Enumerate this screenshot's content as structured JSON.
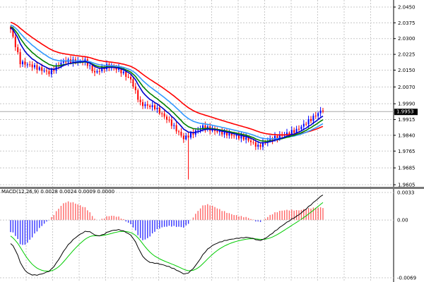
{
  "chart_data": {
    "type": "candlestick",
    "main": {
      "price_axis_labels": [
        "2.0450",
        "2.0375",
        "2.0300",
        "2.0225",
        "2.0150",
        "2.0070",
        "1.9990",
        "1.9915",
        "1.9840",
        "1.9765",
        "1.9685",
        "1.9605"
      ],
      "current_price": "1.9953",
      "ylim": [
        1.9605,
        2.0475
      ],
      "close_keypoints": [
        [
          0,
          2.0345
        ],
        [
          4,
          2.0187
        ],
        [
          9,
          2.017
        ],
        [
          16,
          2.0137
        ],
        [
          22,
          2.0193
        ],
        [
          31,
          2.0193
        ],
        [
          35,
          2.0137
        ],
        [
          40,
          2.017
        ],
        [
          45,
          2.0154
        ],
        [
          50,
          2.0105
        ],
        [
          54,
          1.9989
        ],
        [
          60,
          1.9973
        ],
        [
          66,
          1.9907
        ],
        [
          72,
          1.9825
        ],
        [
          76,
          1.9851
        ],
        [
          80,
          1.9881
        ],
        [
          86,
          1.9858
        ],
        [
          92,
          1.9841
        ],
        [
          98,
          1.9825
        ],
        [
          103,
          1.9786
        ],
        [
          107,
          1.9815
        ],
        [
          113,
          1.9841
        ],
        [
          119,
          1.9864
        ],
        [
          125,
          1.9917
        ],
        [
          130,
          1.9963
        ]
      ],
      "spike_low": {
        "bar": 74,
        "price": 1.963
      },
      "moving_averages": [
        {
          "period": 8,
          "color": "#0000cc"
        },
        {
          "period": 13,
          "color": "#008000"
        },
        {
          "period": 21,
          "color": "#3399ff"
        },
        {
          "period": 34,
          "color": "#ff0000"
        }
      ],
      "bull_color": "#0000ff",
      "bear_color": "#ff0000"
    },
    "macd": {
      "title": "MACD(12,26,9) 0.0028 0.0024 0.0009 0.0000",
      "axis_labels": [
        "0.0033",
        "0.00",
        "-0.0069"
      ],
      "ylim": [
        -0.0069,
        0.0033
      ],
      "main_color": "#000000",
      "signal_color": "#00cc00",
      "hist_pos_color": "#ff6666",
      "hist_neg_color": "#3333ff"
    }
  }
}
